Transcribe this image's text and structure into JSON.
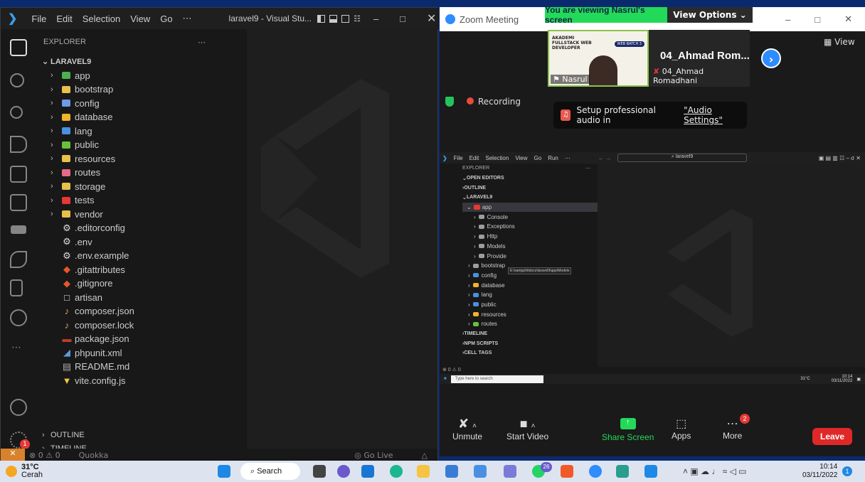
{
  "vscode": {
    "menu": [
      "File",
      "Edit",
      "Selection",
      "View",
      "Go",
      "⋯"
    ],
    "title": "laravel9 - Visual Stu...",
    "explorer_label": "EXPLORER",
    "explorer_more": "⋯",
    "root": "LARAVEL9",
    "folders": [
      {
        "name": "app",
        "color": "#4caf50"
      },
      {
        "name": "bootstrap",
        "color": "#e8c14a"
      },
      {
        "name": "config",
        "color": "#6f9be8"
      },
      {
        "name": "database",
        "color": "#f0b429"
      },
      {
        "name": "lang",
        "color": "#4a90e2"
      },
      {
        "name": "public",
        "color": "#67c23a"
      },
      {
        "name": "resources",
        "color": "#e8c14a"
      },
      {
        "name": "routes",
        "color": "#e66a8a"
      },
      {
        "name": "storage",
        "color": "#e8c14a"
      },
      {
        "name": "tests",
        "color": "#e53935"
      },
      {
        "name": "vendor",
        "color": "#e8c14a"
      }
    ],
    "files": [
      {
        "name": ".editorconfig",
        "glyph": "⚙",
        "color": "#ddd"
      },
      {
        "name": ".env",
        "glyph": "⚙",
        "color": "#ddd"
      },
      {
        "name": ".env.example",
        "glyph": "⚙",
        "color": "#ddd"
      },
      {
        "name": ".gitattributes",
        "glyph": "◆",
        "color": "#e8562a"
      },
      {
        "name": ".gitignore",
        "glyph": "◆",
        "color": "#e8562a"
      },
      {
        "name": "artisan",
        "glyph": "□",
        "color": "#ddd"
      },
      {
        "name": "composer.json",
        "glyph": "♪",
        "color": "#d9a56b"
      },
      {
        "name": "composer.lock",
        "glyph": "♪",
        "color": "#d9a56b"
      },
      {
        "name": "package.json",
        "glyph": "▬",
        "color": "#c0392b"
      },
      {
        "name": "phpunit.xml",
        "glyph": "◢",
        "color": "#5b9bd5"
      },
      {
        "name": "README.md",
        "glyph": "▤",
        "color": "#aaa"
      },
      {
        "name": "vite.config.js",
        "glyph": "▼",
        "color": "#f6c343"
      }
    ],
    "outline": "OUTLINE",
    "timeline": "TIMELINE",
    "status": {
      "counts": "⊗ 0 ⚠ 0",
      "quokka": "Quokka",
      "golive": "◎ Go Live"
    },
    "badge": "1"
  },
  "zoom": {
    "title": "Zoom Meeting",
    "banner": "You are viewing Nasrul's screen",
    "view_options": "View Options ⌄",
    "participant_big": "04_Ahmad Rom...",
    "participant_small": "04_Ahmad Romadhani",
    "self_name": "Nasrul",
    "thumb_lines": [
      "AKADEMI",
      "FULLSTACK WEB",
      "DEVELOPER"
    ],
    "thumb_batch": "WEB BATCH 3",
    "view": "View",
    "recording": "Recording",
    "audio_tip": "Setup professional audio in ",
    "audio_link": "\"Audio Settings\"",
    "inner": {
      "menu": [
        "File",
        "Edit",
        "Selection",
        "View",
        "Go",
        "Run",
        "⋯"
      ],
      "search": "laravel9",
      "explorer": "EXPLORER",
      "sections": [
        "OPEN EDITORS",
        "OUTLINE",
        "LARAVEL9"
      ],
      "app": "app",
      "app_children": [
        "Console",
        "Exceptions",
        "Http",
        "Models",
        "Provide"
      ],
      "tooltip": "E:\\xampp\\htdocs\\laravel9\\app\\Models",
      "folders": [
        "bootstrap",
        "config",
        "database",
        "lang",
        "public",
        "resources",
        "routes"
      ],
      "bottom": [
        "TIMELINE",
        "NPM SCRIPTS",
        "CELL TAGS"
      ],
      "status": "⊗ 0 ⚠ 0",
      "taskbar_search": "Type here to search",
      "weather": "31°C",
      "time": "10:14",
      "date": "03/11/2022"
    },
    "controls": {
      "unmute": "Unmute",
      "video": "Start Video",
      "share": "Share Screen",
      "apps": "Apps",
      "more": "More",
      "more_badge": "2",
      "leave": "Leave"
    }
  },
  "taskbar": {
    "temp": "31°C",
    "weather": "Cerah",
    "search": "Search",
    "badge": "26",
    "time": "10:14",
    "date": "03/11/2022",
    "notif": "1"
  }
}
